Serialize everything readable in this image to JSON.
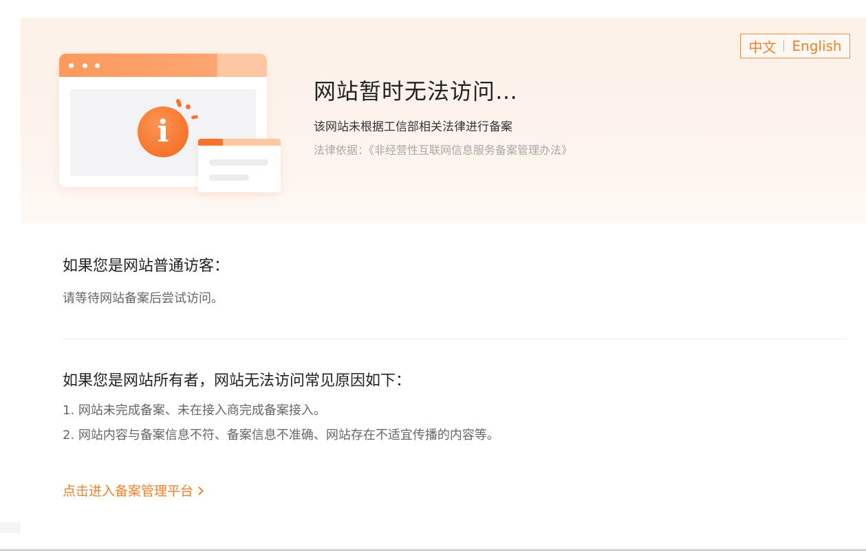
{
  "language_switch": {
    "zh": "中文",
    "en": "English"
  },
  "hero": {
    "title": "网站暂时无法访问…",
    "description": "该网站未根据工信部相关法律进行备案",
    "legal_basis": "法律依据：《非经营性互联网信息服务备案管理办法》",
    "illustration_icon": "info-icon",
    "illustration_glyph": "i"
  },
  "visitor_section": {
    "heading": "如果您是网站普通访客：",
    "text": "请等待网站备案后尝试访问。"
  },
  "owner_section": {
    "heading": "如果您是网站所有者，网站无法访问常见原因如下：",
    "reasons": [
      "1. 网站未完成备案、未在接入商完成备案接入。",
      "2. 网站内容与备案信息不符、备案信息不准确、网站存在不适宜传播的内容等。"
    ]
  },
  "link": {
    "label": "点击进入备案管理平台",
    "icon": "chevron-right-icon"
  },
  "colors": {
    "accent": "#f07f2b",
    "hero_bg": "#fdf1e8",
    "title_text": "#222222",
    "body_text": "#666666",
    "muted_text": "#a8a8a8"
  }
}
